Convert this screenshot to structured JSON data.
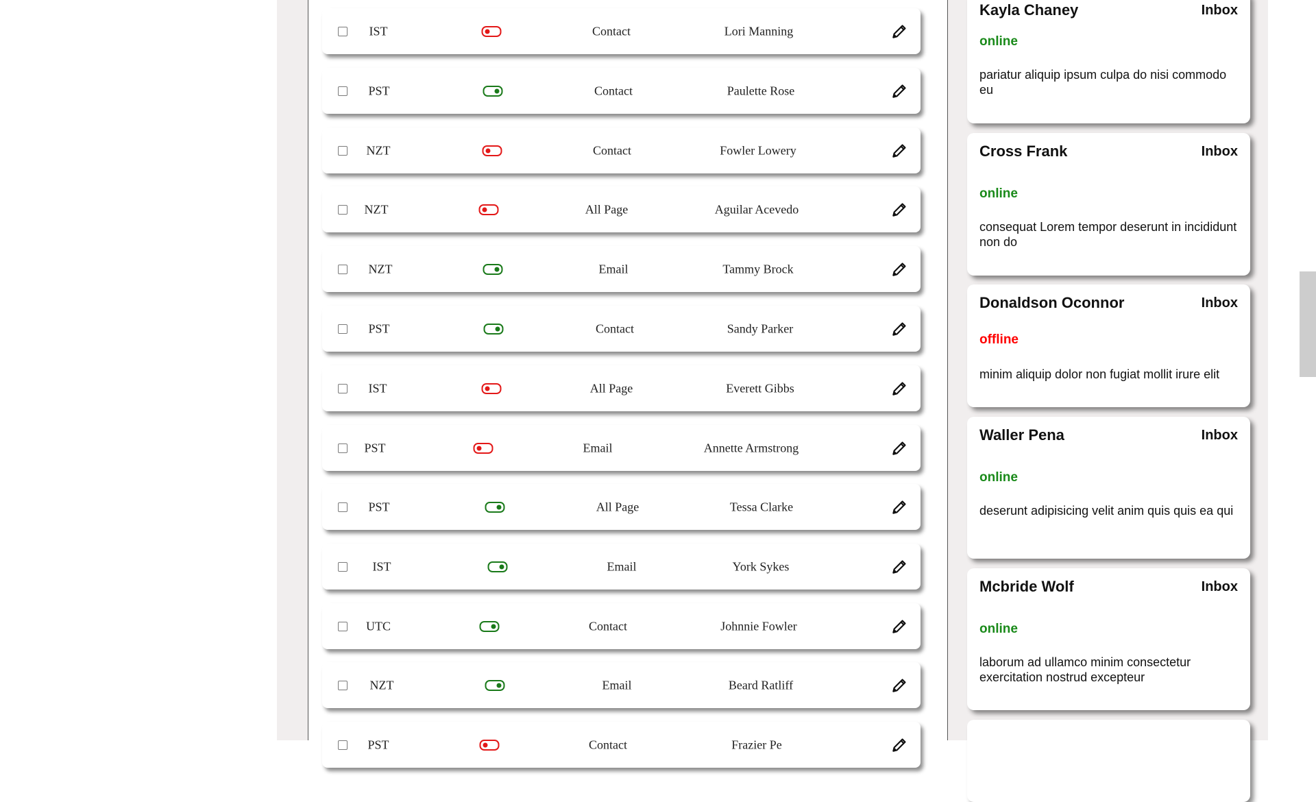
{
  "rows": [
    {
      "timezone": "IST",
      "status": "off",
      "page_type": "Contact",
      "name": "Lori Manning"
    },
    {
      "timezone": "PST",
      "status": "on",
      "page_type": "Contact",
      "name": "Paulette Rose"
    },
    {
      "timezone": "NZT",
      "status": "off",
      "page_type": "Contact",
      "name": "Fowler Lowery"
    },
    {
      "timezone": "NZT",
      "status": "off",
      "page_type": "All Page",
      "name": "Aguilar Acevedo"
    },
    {
      "timezone": "NZT",
      "status": "on",
      "page_type": "Email",
      "name": "Tammy Brock"
    },
    {
      "timezone": "PST",
      "status": "on",
      "page_type": "Contact",
      "name": "Sandy Parker"
    },
    {
      "timezone": "IST",
      "status": "off",
      "page_type": "All Page",
      "name": "Everett Gibbs"
    },
    {
      "timezone": "PST",
      "status": "off",
      "page_type": "Email",
      "name": "Annette Armstrong"
    },
    {
      "timezone": "PST",
      "status": "on",
      "page_type": "All Page",
      "name": "Tessa Clarke"
    },
    {
      "timezone": "IST",
      "status": "on",
      "page_type": "Email",
      "name": "York Sykes"
    },
    {
      "timezone": "UTC",
      "status": "on",
      "page_type": "Contact",
      "name": "Johnnie Fowler"
    },
    {
      "timezone": "NZT",
      "status": "on",
      "page_type": "Email",
      "name": "Beard Ratliff"
    },
    {
      "timezone": "PST",
      "status": "off",
      "page_type": "Contact",
      "name": "Frazier Pe"
    }
  ],
  "cards": [
    {
      "name": "Kayla Chaney",
      "inbox_label": "Inbox",
      "status": "online",
      "message": "pariatur aliquip ipsum culpa do nisi commodo eu"
    },
    {
      "name": "Cross Frank",
      "inbox_label": "Inbox",
      "status": "online",
      "message": "consequat Lorem tempor deserunt in incididunt non do"
    },
    {
      "name": "Donaldson Oconnor",
      "inbox_label": "Inbox",
      "status": "offline",
      "message": "minim aliquip dolor non fugiat mollit irure elit"
    },
    {
      "name": "Waller Pena",
      "inbox_label": "Inbox",
      "status": "online",
      "message": "deserunt adipisicing velit anim quis quis ea qui"
    },
    {
      "name": "Mcbride Wolf",
      "inbox_label": "Inbox",
      "status": "online",
      "message": "laborum ad ullamco minim consectetur exercitation nostrud excepteur"
    }
  ],
  "icons": {
    "edit": "pencil-icon",
    "checkbox": "checkbox-icon",
    "status_toggle": "toggle-icon"
  },
  "colors": {
    "online": "#1a8a1a",
    "offline": "#ff0000",
    "toggle_on": "#1a7a1a",
    "toggle_off": "#e31818"
  }
}
